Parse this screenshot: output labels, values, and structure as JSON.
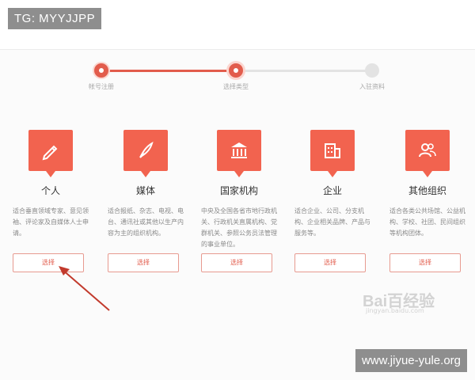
{
  "overlay": {
    "tag": "TG: MYYJJPP",
    "url": "www.jiyue-yule.org"
  },
  "stepper": {
    "steps": [
      {
        "label": "帐号注册",
        "state": "done"
      },
      {
        "label": "选择类型",
        "state": "current"
      },
      {
        "label": "入驻资料",
        "state": "todo"
      }
    ],
    "accent_color": "#e25c4c"
  },
  "cards": [
    {
      "title": "个人",
      "desc": "适合垂直领域专家、意见领袖、评论家及自媒体人士申请。",
      "button": "选择",
      "icon": "pencil-icon"
    },
    {
      "title": "媒体",
      "desc": "适合报纸、杂志、电视、电台、通讯社或其他以生产内容为主的组织机构。",
      "button": "选择",
      "icon": "quill-icon"
    },
    {
      "title": "国家机构",
      "desc": "中央及全国各省市地行政机关、行政机关直属机构、党群机关、参照公务员法管理的事业单位。",
      "button": "选择",
      "icon": "government-building-icon"
    },
    {
      "title": "企业",
      "desc": "适合企业、公司、分支机构、企业相关品牌、产品与服务等。",
      "button": "选择",
      "icon": "office-building-icon"
    },
    {
      "title": "其他组织",
      "desc": "适合各类公共场馆、公益机构、学校、社团、民间组织等机构团体。",
      "button": "选择",
      "icon": "people-icon"
    }
  ],
  "watermark": {
    "brand": "Bai百经验",
    "sub": "jingyan.baidu.com"
  },
  "colors": {
    "card_accent": "#f2634f",
    "button_border": "#e79a90"
  }
}
